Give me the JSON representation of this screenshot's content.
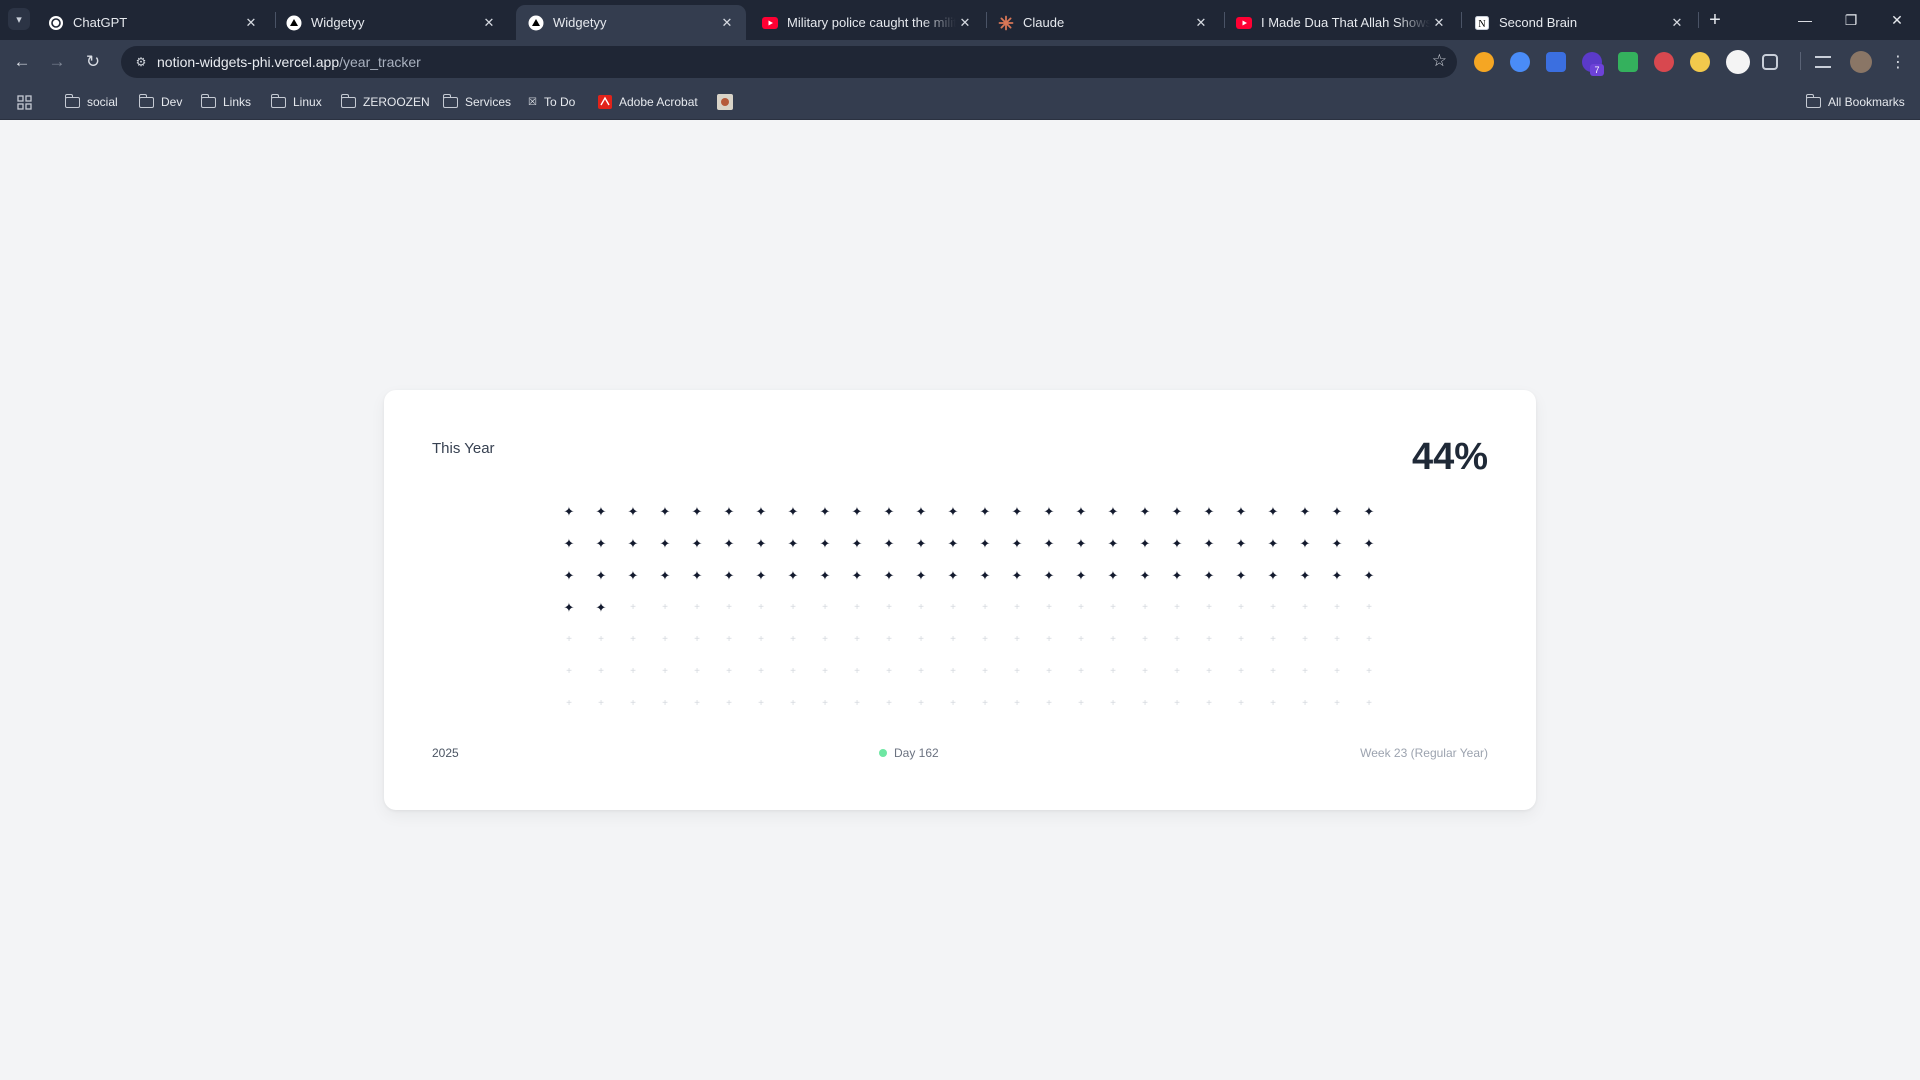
{
  "browser": {
    "tabs": [
      {
        "title": "ChatGPT",
        "icon": "chatgpt-icon",
        "active": false
      },
      {
        "title": "Widgetyy",
        "icon": "vercel-icon",
        "active": false
      },
      {
        "title": "Widgetyy",
        "icon": "vercel-icon",
        "active": true
      },
      {
        "title": "Military police caught the milita",
        "icon": "youtube-icon",
        "active": false
      },
      {
        "title": "Claude",
        "icon": "claude-icon",
        "active": false
      },
      {
        "title": "I Made Dua That Allah Shows T",
        "icon": "youtube-icon",
        "active": false
      },
      {
        "title": "Second Brain",
        "icon": "notion-icon",
        "active": false
      }
    ],
    "url_host": "notion-widgets-phi.vercel.app",
    "url_path": "/year_tracker",
    "bookmarks": [
      {
        "label": "social",
        "icon": "folder-icon"
      },
      {
        "label": "Dev",
        "icon": "folder-icon"
      },
      {
        "label": "Links",
        "icon": "folder-icon"
      },
      {
        "label": "Linux",
        "icon": "folder-icon"
      },
      {
        "label": "ZEROOZEN",
        "icon": "folder-icon"
      },
      {
        "label": "Services",
        "icon": "folder-icon"
      },
      {
        "label": "To Do",
        "icon": "todo-icon"
      },
      {
        "label": "Adobe Acrobat",
        "icon": "acrobat-icon"
      }
    ],
    "all_bookmarks_label": "All Bookmarks",
    "colors": {
      "tabstrip": "#1f2635",
      "toolbar": "#343d4f",
      "youtube": "#ff0033",
      "acrobat": "#e2231a"
    }
  },
  "widget": {
    "label": "This Year",
    "percent": "44%",
    "year": "2025",
    "day": "Day 162",
    "week": "Week 23 (Regular Year)",
    "grid": {
      "columns": 26,
      "rows": 7,
      "filled": 80
    },
    "colors": {
      "filled": "#131a2e",
      "future": "#d4d8de",
      "status_dot": "#6ee7a3"
    }
  }
}
